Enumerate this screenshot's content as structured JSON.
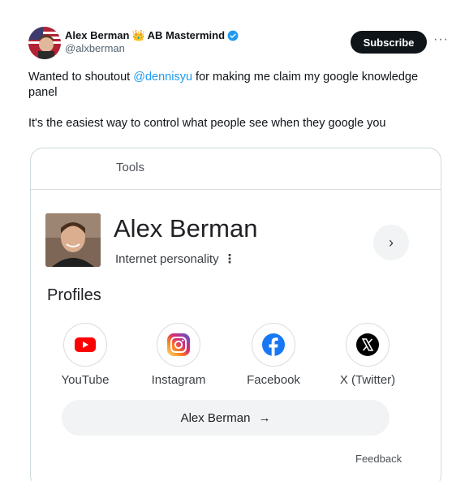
{
  "tweet": {
    "display_name": "Alex Berman",
    "crown_emoji": "👑",
    "display_name_suffix": "AB Mastermind",
    "handle": "@alxberman",
    "subscribe_label": "Subscribe",
    "more_label": "···",
    "text_line1_pre": "Wanted to shoutout ",
    "mention": "@dennisyu",
    "text_line1_post": " for making me claim my google knowledge panel",
    "text_line2": "It's the easiest way to control what people see when they google you"
  },
  "card": {
    "tools_label": "Tools",
    "name": "Alex Berman",
    "subtitle": "Internet personality",
    "chevron": "›",
    "profiles_title": "Profiles",
    "profiles": [
      {
        "label": "YouTube",
        "icon": "youtube-icon",
        "color": "#ff0000"
      },
      {
        "label": "Instagram",
        "icon": "instagram-icon",
        "color": "#e1306c"
      },
      {
        "label": "Facebook",
        "icon": "facebook-icon",
        "color": "#1877f2"
      },
      {
        "label": "X (Twitter)",
        "icon": "x-twitter-icon",
        "color": "#000000"
      }
    ],
    "pill_label": "Alex Berman",
    "pill_arrow": "→",
    "feedback_label": "Feedback"
  },
  "colors": {
    "link": "#1d9bf0",
    "verified": "#1d9bf0",
    "subscribe_bg": "#0f1419"
  }
}
